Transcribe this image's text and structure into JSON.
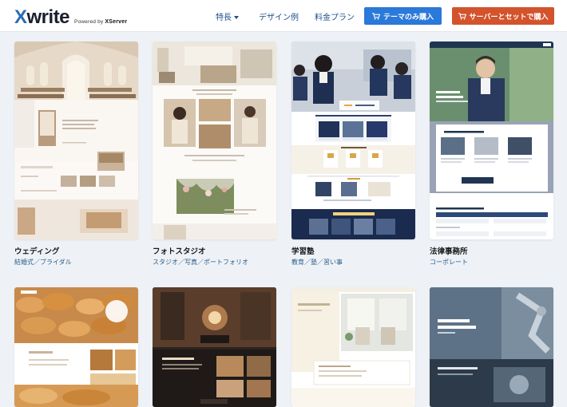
{
  "header": {
    "logo_main": "write",
    "logo_x": "X",
    "logo_powered": "Powered by ",
    "logo_powered_brand": "XServer",
    "nav": [
      {
        "label": "特長"
      },
      {
        "label": "デザイン例"
      },
      {
        "label": "料金プラン"
      }
    ],
    "btn_theme": "テーマのみ購入",
    "btn_server": "サーバーとセットで購入"
  },
  "cards": [
    {
      "title": "ウェディング",
      "tags": "結婚式／ブライダル"
    },
    {
      "title": "フォトスタジオ",
      "tags": "スタジオ／写真／ポートフォリオ"
    },
    {
      "title": "学習塾",
      "tags": "教育／塾／習い事"
    },
    {
      "title": "法律事務所",
      "tags": "コーポレート"
    }
  ],
  "colors": {
    "accent_blue": "#2b79d9",
    "accent_red": "#d3532c",
    "nav_text": "#1e4f8c",
    "page_bg": "#eef2f6"
  }
}
